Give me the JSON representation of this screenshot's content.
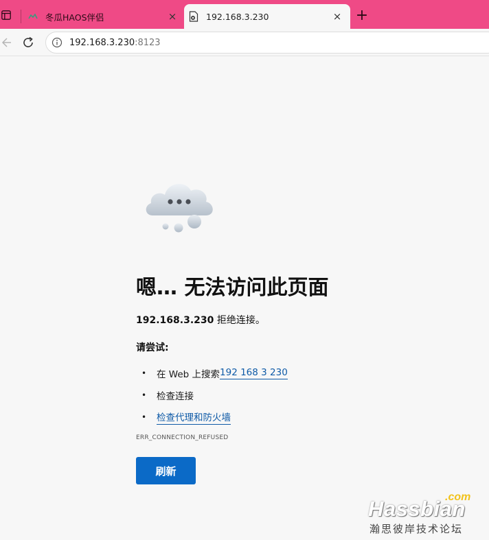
{
  "tabs": [
    {
      "title": "冬瓜HAOS伴侣",
      "close": "×",
      "active": false
    },
    {
      "title": "192.168.3.230",
      "close": "×",
      "active": true
    }
  ],
  "new_tab": "+",
  "address": {
    "host": "192.168.3.230",
    "port": ":8123"
  },
  "error": {
    "heading": "嗯… 无法访问此页面",
    "host": "192.168.3.230",
    "message": " 拒绝连接。",
    "try_label": "请尝试:",
    "suggestions": [
      {
        "prefix": "在 Web 上搜索 ",
        "link": "192 168 3 230"
      },
      {
        "prefix": "检查连接",
        "link": ""
      },
      {
        "prefix": "",
        "link": "检查代理和防火墙"
      }
    ],
    "code": "ERR_CONNECTION_REFUSED",
    "refresh_label": "刷新"
  },
  "watermark": {
    "dotcom": ".com",
    "brand": "Hassbian",
    "sub": "瀚思彼岸技术论坛"
  },
  "colors": {
    "tabbar": "#ef4a86",
    "link": "#0e5aa7",
    "button": "#0b6ac7"
  }
}
